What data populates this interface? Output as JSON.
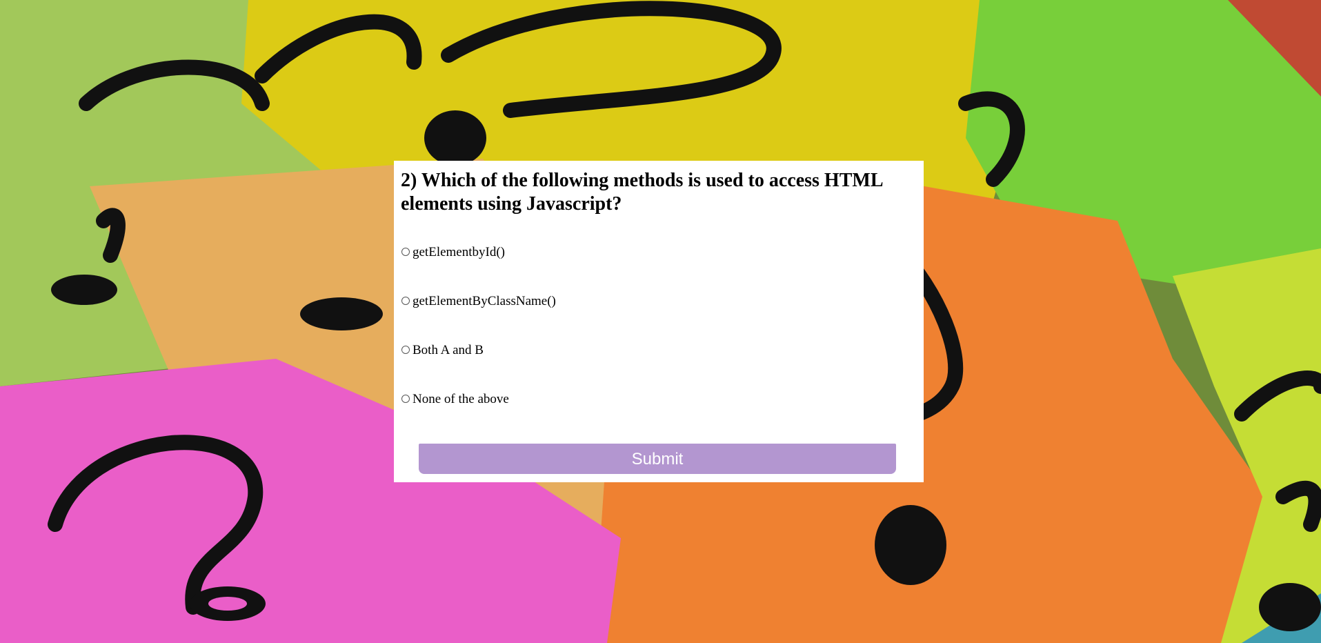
{
  "quiz": {
    "question": "2) Which of the following methods is used to access HTML elements using Javascript?",
    "options": [
      {
        "label": "getElementbyId()",
        "selected": false
      },
      {
        "label": "getElementByClassName()",
        "selected": false
      },
      {
        "label": "Both A and B",
        "selected": false
      },
      {
        "label": "None of the above",
        "selected": false
      }
    ],
    "submit_label": "Submit"
  },
  "colors": {
    "card_background": "#ffffff",
    "submit_button": "#b396d0",
    "submit_text": "#ffffff"
  },
  "background": {
    "description_icon": "question-mark-sticky-notes",
    "note_colors": [
      "#9cc94f",
      "#e3cf12",
      "#7ad139",
      "#e3a95a",
      "#ee7f2e",
      "#e85fc7",
      "#c2df3a"
    ]
  }
}
